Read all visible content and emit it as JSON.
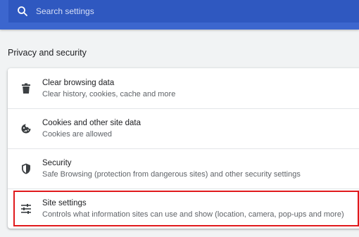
{
  "search": {
    "placeholder": "Search settings",
    "icon": "search-icon"
  },
  "section": {
    "title": "Privacy and security"
  },
  "items": [
    {
      "title": "Clear browsing data",
      "subtitle": "Clear history, cookies, cache and more",
      "icon": "trash-icon"
    },
    {
      "title": "Cookies and other site data",
      "subtitle": "Cookies are allowed",
      "icon": "cookie-icon"
    },
    {
      "title": "Security",
      "subtitle": "Safe Browsing (protection from dangerous sites) and other security settings",
      "icon": "shield-icon"
    },
    {
      "title": "Site settings",
      "subtitle": "Controls what information sites can use and show (location, camera, pop-ups and more)",
      "icon": "sliders-icon",
      "highlighted": true
    }
  ],
  "colors": {
    "header": "#3c66ce",
    "highlight_border": "#e0191c"
  }
}
